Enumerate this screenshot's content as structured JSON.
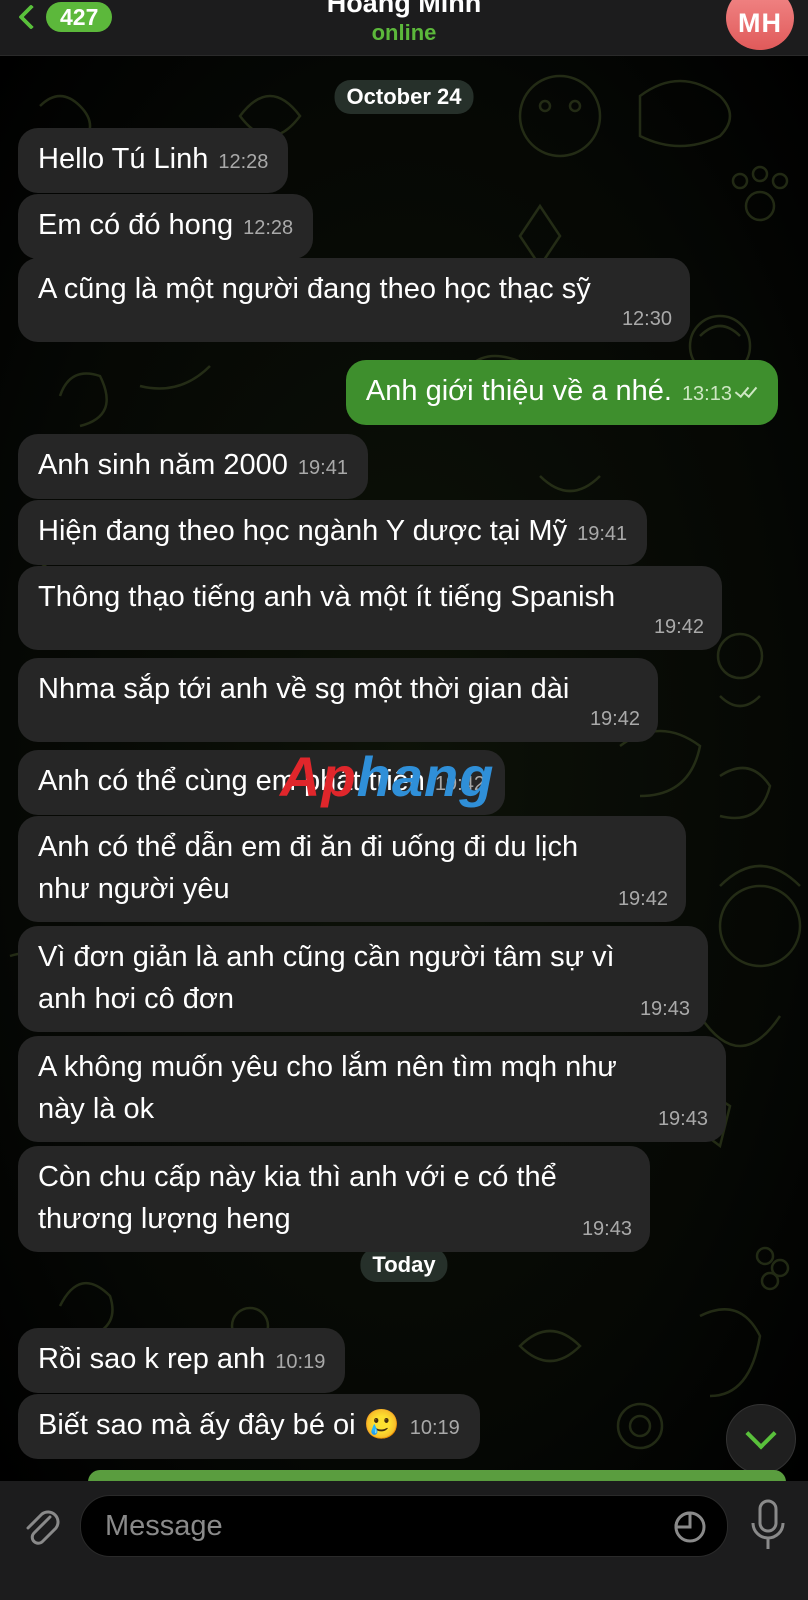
{
  "header": {
    "back_count": "427",
    "title": "Hoàng Minh",
    "status": "online",
    "avatar_initials": "MH",
    "avatar_color": "#e86a6a"
  },
  "watermark": {
    "part1": "Ap",
    "part2": "hang"
  },
  "date_chips": {
    "first": "October 24",
    "second": "Today"
  },
  "messages": [
    {
      "dir": "in",
      "text": "Hello Tú Linh",
      "time": "12:28"
    },
    {
      "dir": "in",
      "text": "Em có đó hong",
      "time": "12:28"
    },
    {
      "dir": "in",
      "text": "A cũng là một người đang theo học thạc sỹ",
      "time": "12:30"
    },
    {
      "dir": "out",
      "text": "Anh giới thiệu về a nhé.",
      "time": "13:13"
    },
    {
      "dir": "in",
      "text": "Anh sinh năm 2000",
      "time": "19:41"
    },
    {
      "dir": "in",
      "text": "Hiện đang theo học ngành Y dược tại Mỹ",
      "time": "19:41"
    },
    {
      "dir": "in",
      "text": "Thông thạo tiếng anh và một ít tiếng Spanish",
      "time": "19:42"
    },
    {
      "dir": "in",
      "text": "Nhma sắp tới anh về sg một thời gian dài",
      "time": "19:42"
    },
    {
      "dir": "in",
      "text": "Anh có thể cùng em phát triển",
      "time": "19:42"
    },
    {
      "dir": "in",
      "line1": "Anh có thể dẫn em đi ăn đi uống đi du lịch",
      "line2": "như người yêu",
      "time": "19:42"
    },
    {
      "dir": "in",
      "line1": "Vì đơn giản là anh cũng cần người tâm sự vì",
      "line2": "anh hơi cô đơn",
      "time": "19:43"
    },
    {
      "dir": "in",
      "line1": "A không muốn yêu cho lắm nên tìm mqh như",
      "line2": "này là ok",
      "time": "19:43"
    },
    {
      "dir": "in",
      "line1": "Còn chu cấp này kia thì anh với e có thể",
      "line2": "thương lượng heng",
      "time": "19:43"
    },
    {
      "dir": "in",
      "text": "Rồi sao k rep anh",
      "time": "10:19"
    },
    {
      "dir": "in",
      "text": "Biết sao mà ấy đây bé oi",
      "emoji": "🥲",
      "time": "10:19"
    }
  ],
  "composer": {
    "placeholder": "Message"
  },
  "colors": {
    "accent": "#5cb83b",
    "outgoing_bubble": "#3e8f2d",
    "incoming_bubble": "#262626"
  }
}
